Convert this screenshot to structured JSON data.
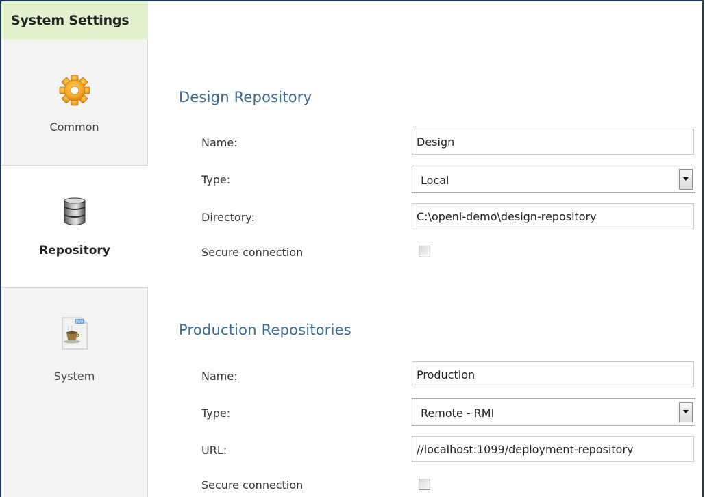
{
  "sidebar": {
    "title": "System Settings",
    "items": [
      {
        "label": "Common",
        "icon": "gear-icon",
        "active": false
      },
      {
        "label": "Repository",
        "icon": "database-icon",
        "active": true
      },
      {
        "label": "System",
        "icon": "java-icon",
        "active": false
      }
    ]
  },
  "design_repository": {
    "title": "Design Repository",
    "name_label": "Name:",
    "name_value": "Design",
    "type_label": "Type:",
    "type_value": "Local",
    "directory_label": "Directory:",
    "directory_value": "C:\\openl-demo\\design-repository",
    "secure_label": "Secure connection",
    "secure_checked": false
  },
  "production_repositories": {
    "title": "Production Repositories",
    "name_label": "Name:",
    "name_value": "Production",
    "type_label": "Type:",
    "type_value": "Remote - RMI",
    "url_label": "URL:",
    "url_value": "//localhost:1099/deployment-repository",
    "secure_label": "Secure connection",
    "secure_checked": false
  },
  "colors": {
    "header_bg": "#e2f2cf",
    "section_title": "#3a6b94",
    "frame_border": "#1d3a5c",
    "gear_orange": "#f5a623"
  }
}
